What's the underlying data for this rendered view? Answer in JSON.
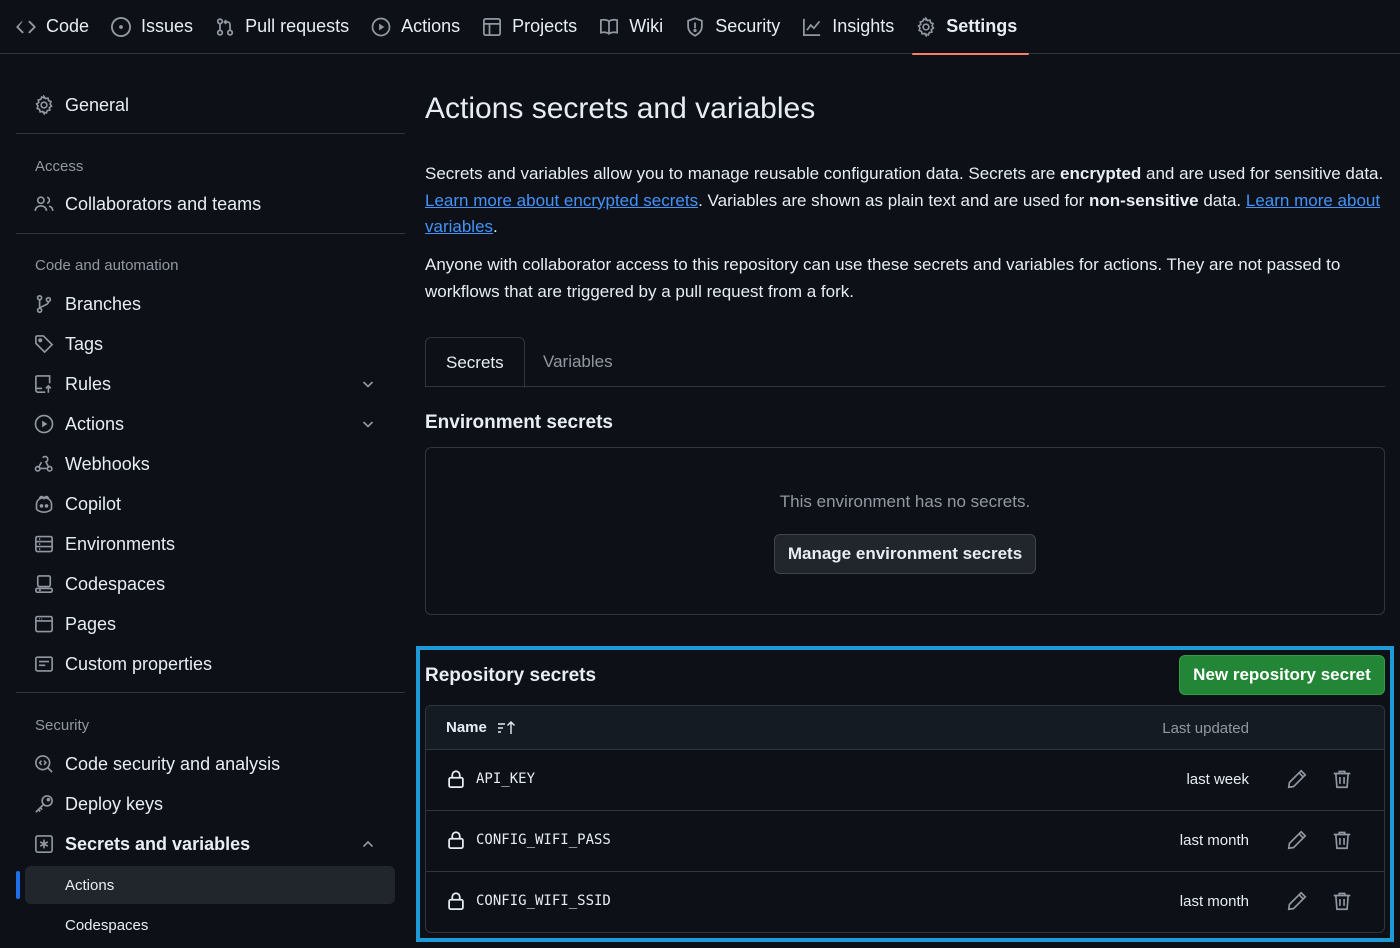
{
  "topnav": {
    "items": [
      {
        "label": "Code",
        "icon": "code-icon"
      },
      {
        "label": "Issues",
        "icon": "issue-icon"
      },
      {
        "label": "Pull requests",
        "icon": "pull-request-icon"
      },
      {
        "label": "Actions",
        "icon": "play-icon"
      },
      {
        "label": "Projects",
        "icon": "table-icon"
      },
      {
        "label": "Wiki",
        "icon": "book-icon"
      },
      {
        "label": "Security",
        "icon": "shield-icon"
      },
      {
        "label": "Insights",
        "icon": "graph-icon"
      },
      {
        "label": "Settings",
        "icon": "gear-icon",
        "active": true
      }
    ]
  },
  "sidebar": {
    "general": "General",
    "access_heading": "Access",
    "collaborators": "Collaborators and teams",
    "code_automation_heading": "Code and automation",
    "branches": "Branches",
    "tags": "Tags",
    "rules": "Rules",
    "actions": "Actions",
    "webhooks": "Webhooks",
    "copilot": "Copilot",
    "environments": "Environments",
    "codespaces": "Codespaces",
    "pages": "Pages",
    "custom_properties": "Custom properties",
    "security_heading": "Security",
    "code_security": "Code security and analysis",
    "deploy_keys": "Deploy keys",
    "secrets_variables": "Secrets and variables",
    "sub_actions": "Actions",
    "sub_codespaces": "Codespaces"
  },
  "main": {
    "title": "Actions secrets and variables",
    "para1": {
      "t1": "Secrets and variables allow you to manage reusable configuration data. Secrets are ",
      "b1": "encrypted",
      "t2": " and are used for sensitive data. ",
      "link1": "Learn more about encrypted secrets",
      "t3": ". Variables are shown as plain text and are used for ",
      "b2": "non-sensitive",
      "t4": " data. ",
      "link2": "Learn more about variables",
      "t5": "."
    },
    "para2": "Anyone with collaborator access to this repository can use these secrets and variables for actions. They are not passed to workflows that are triggered by a pull request from a fork.",
    "tabs": {
      "secrets": "Secrets",
      "variables": "Variables"
    },
    "env_secrets_title": "Environment secrets",
    "env_empty_msg": "This environment has no secrets.",
    "manage_env_button": "Manage environment secrets",
    "repo_secrets_title": "Repository secrets",
    "new_secret_button": "New repository secret",
    "table": {
      "col_name": "Name",
      "col_updated": "Last updated",
      "rows": [
        {
          "name": "API_KEY",
          "updated": "last week"
        },
        {
          "name": "CONFIG_WIFI_PASS",
          "updated": "last month"
        },
        {
          "name": "CONFIG_WIFI_SSID",
          "updated": "last month"
        }
      ]
    }
  },
  "colors": {
    "background": "#0d1117",
    "border": "#30363d",
    "link": "#4493f8",
    "primary_button": "#238636",
    "active_tab_underline": "#f78166",
    "highlight_box": "#1e9ad6"
  }
}
